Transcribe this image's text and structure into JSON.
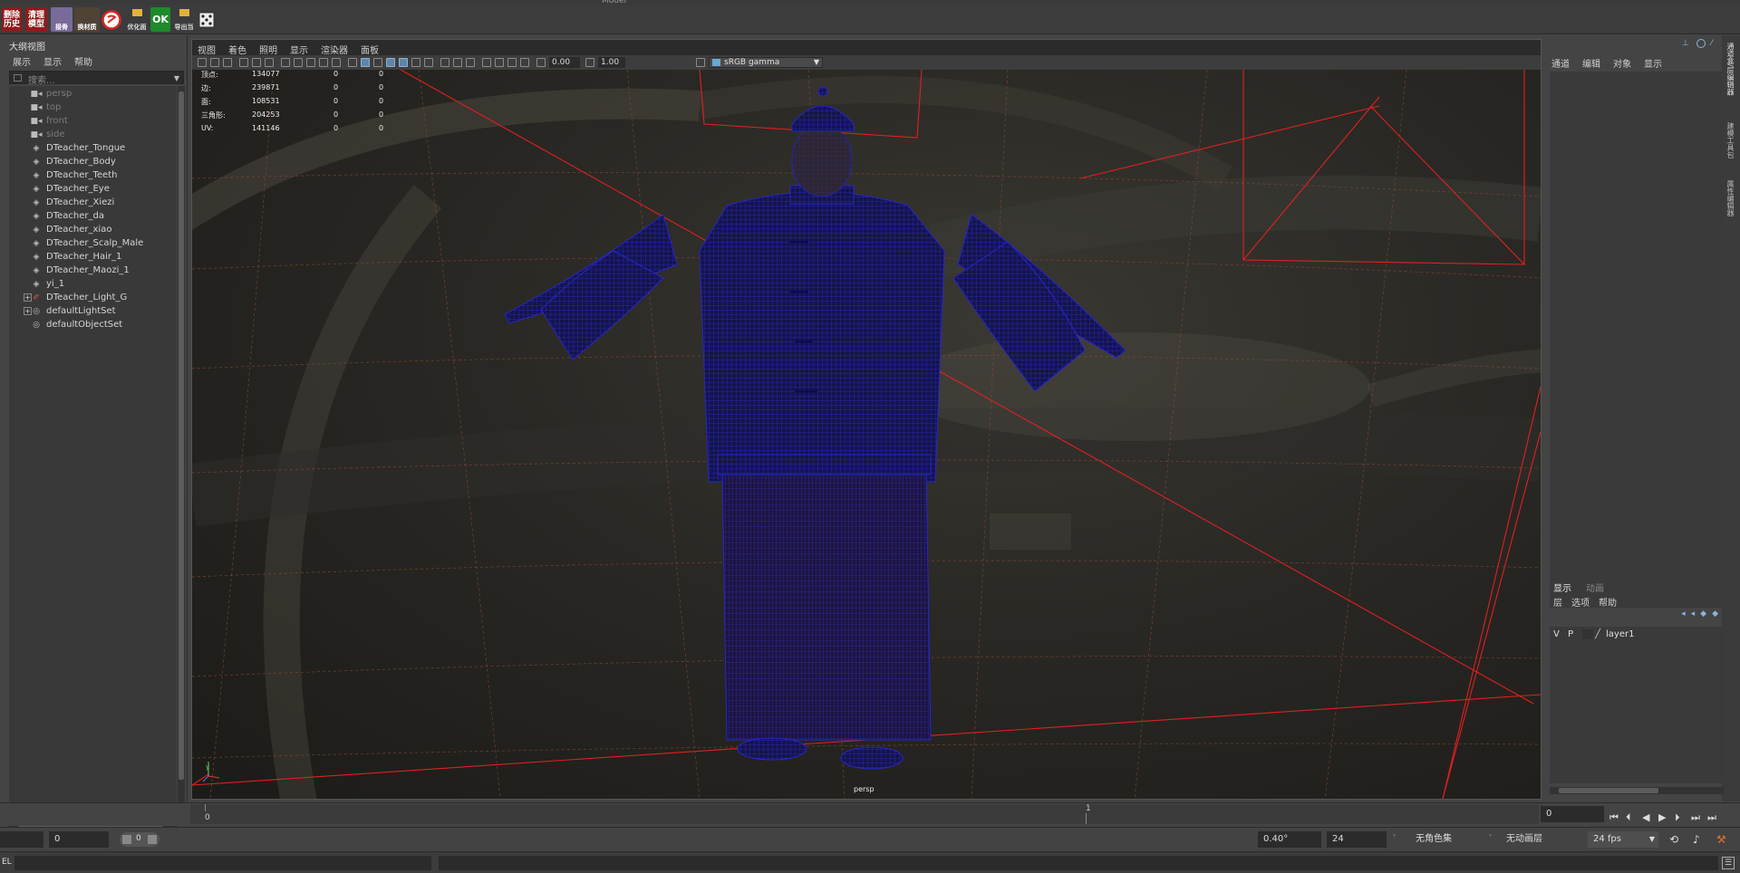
{
  "top_menu": [
    "Model"
  ],
  "shelf": {
    "buttons": [
      {
        "label": "删除\n历史",
        "color": "#8e1b1b"
      },
      {
        "label": "清理\n模型",
        "color": "#8e1b1b"
      },
      {
        "label": "接骨",
        "color": "#6e5c8a"
      },
      {
        "label": "换材质",
        "color": "#5a4a3a"
      },
      {
        "label": "",
        "color": "#c22"
      },
      {
        "label": "优化面",
        "color": "#3c3c3c"
      },
      {
        "label": "OK",
        "color": "#1d8a2b"
      },
      {
        "label": "导出当",
        "color": "#3c3c3c"
      },
      {
        "label": "",
        "color": "#ddd"
      }
    ]
  },
  "outliner": {
    "title": "大纲视图",
    "menu": [
      "展示",
      "显示",
      "帮助"
    ],
    "search_placeholder": "搜索...",
    "items": [
      {
        "name": "persp",
        "type": "camera",
        "dim": true
      },
      {
        "name": "top",
        "type": "camera",
        "dim": true
      },
      {
        "name": "front",
        "type": "camera",
        "dim": true
      },
      {
        "name": "side",
        "type": "camera",
        "dim": true
      },
      {
        "name": "DTeacher_Tongue",
        "type": "mesh",
        "dim": false
      },
      {
        "name": "DTeacher_Body",
        "type": "mesh",
        "dim": false
      },
      {
        "name": "DTeacher_Teeth",
        "type": "mesh",
        "dim": false
      },
      {
        "name": "DTeacher_Eye",
        "type": "mesh",
        "dim": false
      },
      {
        "name": "DTeacher_Xiezi",
        "type": "mesh",
        "dim": false
      },
      {
        "name": "DTeacher_da",
        "type": "mesh",
        "dim": false
      },
      {
        "name": "DTeacher_xiao",
        "type": "mesh",
        "dim": false
      },
      {
        "name": "DTeacher_Scalp_Male",
        "type": "mesh",
        "dim": false
      },
      {
        "name": "DTeacher_Hair_1",
        "type": "mesh",
        "dim": false
      },
      {
        "name": "DTeacher_Maozi_1",
        "type": "mesh",
        "dim": false
      },
      {
        "name": "yi_1",
        "type": "mesh",
        "dim": false
      },
      {
        "name": "DTeacher_Light_G",
        "type": "light",
        "dim": false,
        "expandable": true
      },
      {
        "name": "defaultLightSet",
        "type": "set",
        "dim": false,
        "expandable": true
      },
      {
        "name": "defaultObjectSet",
        "type": "set",
        "dim": false
      }
    ]
  },
  "viewport": {
    "menu": [
      "视图",
      "着色",
      "照明",
      "显示",
      "渲染器",
      "面板"
    ],
    "exposure": "0.00",
    "gamma": "1.00",
    "color_space": "sRGB gamma",
    "camera_label": "persp",
    "axis_y": "y",
    "hud": [
      {
        "label": "顶点:",
        "v1": "134077",
        "v2": "0",
        "v3": "0"
      },
      {
        "label": "边:",
        "v1": "239871",
        "v2": "0",
        "v3": "0"
      },
      {
        "label": "面:",
        "v1": "108531",
        "v2": "0",
        "v3": "0"
      },
      {
        "label": "三角形:",
        "v1": "204253",
        "v2": "0",
        "v3": "0"
      },
      {
        "label": "UV:",
        "v1": "141146",
        "v2": "0",
        "v3": "0"
      }
    ]
  },
  "channel_box": {
    "menu": [
      "通道",
      "编辑",
      "对象",
      "显示"
    ],
    "side_tabs": [
      "通道盒/层编辑器",
      "建模工具包",
      "属性编辑器"
    ]
  },
  "layer_editor": {
    "tabs": [
      "显示",
      "动画"
    ],
    "menu": [
      "层",
      "选项",
      "帮助"
    ],
    "layers": [
      {
        "v": "V",
        "p": "P",
        "name": "layer1"
      }
    ]
  },
  "timeline": {
    "start_tick": "0",
    "mid_tick": "1",
    "current_frame": "0"
  },
  "range": {
    "start": "0",
    "anim_start": "0",
    "angle": "0.40°",
    "end": "24",
    "character_set": "无角色集",
    "anim_layer": "无动画层",
    "fps": "24 fps"
  },
  "cmdline": {
    "label": "EL"
  }
}
